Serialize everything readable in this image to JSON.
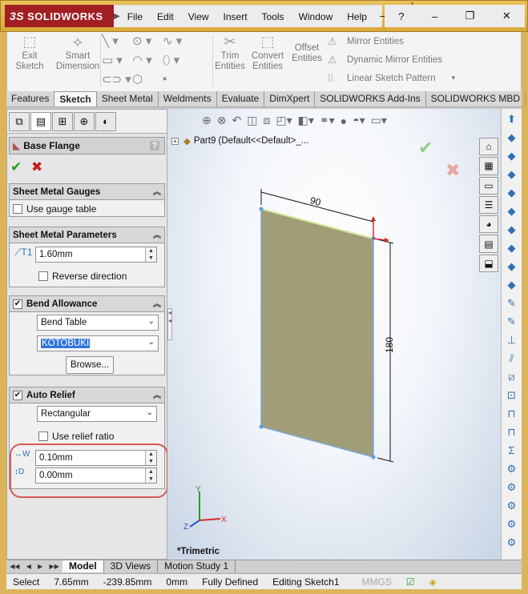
{
  "brand": {
    "ds": "3S",
    "name": "SOLIDWORKS"
  },
  "menu": {
    "items": [
      "File",
      "Edit",
      "View",
      "Insert",
      "Tools",
      "Window",
      "Help"
    ]
  },
  "title_right": {
    "help": "?",
    "minimize": "–",
    "restore": "❐",
    "close": "✕"
  },
  "command_manager": {
    "exit_sketch": "Exit\nSketch",
    "smart_dimension": "Smart\nDimension",
    "trim": "Trim\nEntities",
    "convert": "Convert\nEntities",
    "offset": "Offset\nEntities",
    "mirror": "Mirror Entities",
    "dynamic_mirror": "Dynamic Mirror Entities",
    "linear_pattern": "Linear Sketch Pattern"
  },
  "tabs": [
    "Features",
    "Sketch",
    "Sheet Metal",
    "Weldments",
    "Evaluate",
    "DimXpert",
    "SOLIDWORKS Add-Ins",
    "SOLIDWORKS MBD"
  ],
  "property_manager": {
    "title": "Base Flange",
    "help": "?",
    "gauges": {
      "title": "Sheet Metal Gauges",
      "use_gauge_table": "Use gauge table"
    },
    "parameters": {
      "title": "Sheet Metal Parameters",
      "thickness": "1.60mm",
      "reverse_direction": "Reverse direction"
    },
    "bend_allowance": {
      "title": "Bend Allowance",
      "type": "Bend Table",
      "table": "KOTOBUKI",
      "browse": "Browse..."
    },
    "auto_relief": {
      "title": "Auto Relief",
      "type": "Rectangular",
      "use_relief_ratio": "Use relief ratio",
      "width": "0.10mm",
      "depth": "0.00mm",
      "w_label": "W",
      "d_label": "D"
    }
  },
  "graphics": {
    "tree_text": "Part9  (Default<<Default>_...",
    "view_label": "*Trimetric",
    "dim_width": "90",
    "dim_height": "180",
    "axis_y": "Y",
    "axis_x": "X",
    "axis_z": "Z"
  },
  "bottom_tabs": [
    "Model",
    "3D Views",
    "Motion Study 1"
  ],
  "status": {
    "mode": "Select",
    "x": "7.65mm",
    "y": "-239.85mm",
    "z": "0mm",
    "state": "Fully Defined",
    "editing": "Editing Sketch1",
    "units": "MMGS"
  },
  "colors": {
    "plate": "#a19d78",
    "accent_red": "#d45a59",
    "title_gold": "#dcb45b",
    "ok_green": "#2a9b2a",
    "cancel_red": "#c81e1e"
  }
}
